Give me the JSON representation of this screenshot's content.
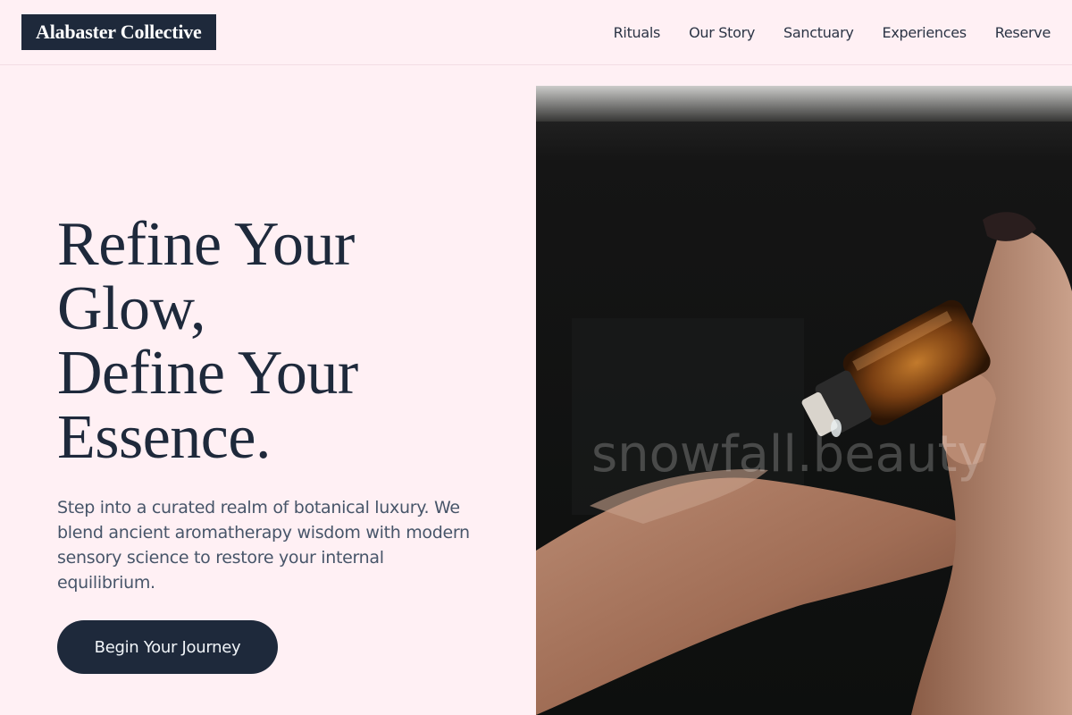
{
  "brand": {
    "name": "Alabaster Collective"
  },
  "nav": {
    "items": [
      {
        "label": "Rituals"
      },
      {
        "label": "Our Story"
      },
      {
        "label": "Sanctuary"
      },
      {
        "label": "Experiences"
      },
      {
        "label": "Reserve"
      }
    ]
  },
  "hero": {
    "headline_lines": [
      "Refine Your",
      "Glow,",
      "Define Your",
      "Essence."
    ],
    "subtext": "Step into a curated realm of botanical luxury. We blend ancient aromatherapy wisdom with modern sensory science to restore your internal equilibrium.",
    "cta_label": "Begin Your Journey",
    "image": {
      "description_icon": "essential-oil-dropper-photo",
      "watermark": "snowfall.beauty"
    }
  },
  "colors": {
    "background": "#fff0f4",
    "primary": "#1e293b",
    "body_text": "#475569"
  }
}
